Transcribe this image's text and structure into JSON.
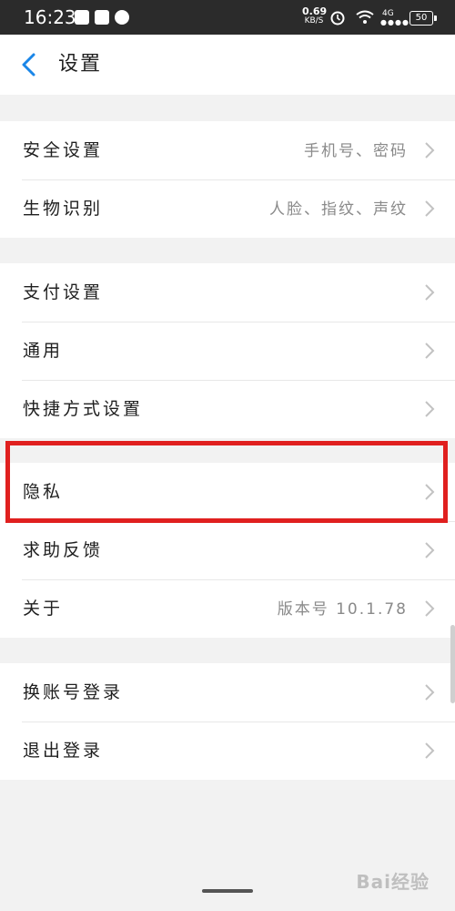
{
  "status_bar": {
    "time": "16:23",
    "net_speed_value": "0.69",
    "net_speed_unit": "KB/S",
    "network": "4G",
    "battery": "50",
    "icons": [
      "yen-icon",
      "mail-icon",
      "qq-icon",
      "alarm-icon",
      "wifi-icon",
      "signal-icon",
      "battery-icon"
    ]
  },
  "header": {
    "title": "设置",
    "back_icon": "chevron-left-icon"
  },
  "groups": [
    {
      "items": [
        {
          "label": "安全设置",
          "value": "手机号、密码"
        },
        {
          "label": "生物识别",
          "value": "人脸、指纹、声纹"
        }
      ]
    },
    {
      "items": [
        {
          "label": "支付设置",
          "value": ""
        },
        {
          "label": "通用",
          "value": ""
        },
        {
          "label": "快捷方式设置",
          "value": ""
        }
      ]
    },
    {
      "items": [
        {
          "label": "隐私",
          "value": ""
        },
        {
          "label": "求助反馈",
          "value": ""
        },
        {
          "label": "关于",
          "value": "版本号 10.1.78"
        }
      ]
    },
    {
      "items": [
        {
          "label": "换账号登录",
          "value": ""
        },
        {
          "label": "退出登录",
          "value": ""
        }
      ]
    }
  ],
  "watermark": "Bai经验",
  "colors": {
    "accent": "#1a86e8",
    "highlight_border": "#e0201f",
    "background": "#f2f2f2",
    "status_bar": "#2b2b2b"
  }
}
